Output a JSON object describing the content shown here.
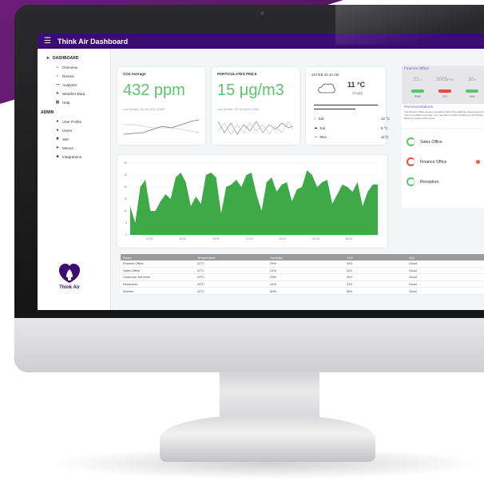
{
  "header": {
    "menu_icon": "menu-icon",
    "title": "Think Air Dashboard"
  },
  "sidebar": {
    "dashboard_heading": "DASHBOARD",
    "dashboard_items": [
      {
        "label": "Overview",
        "icon": "home-icon"
      },
      {
        "label": "Rooms",
        "icon": "home-icon"
      },
      {
        "label": "Analytics",
        "icon": "chart-line-icon"
      },
      {
        "label": "Weather Data",
        "icon": "send-icon"
      },
      {
        "label": "Help",
        "icon": "calendar-icon"
      }
    ],
    "admin_heading": "ADMIN",
    "admin_items": [
      {
        "label": "User Profile",
        "icon": "user-icon"
      },
      {
        "label": "Users",
        "icon": "users-icon"
      },
      {
        "label": "Site",
        "icon": "tools-icon"
      },
      {
        "label": "Menus",
        "icon": "send-icon"
      },
      {
        "label": "Integrations",
        "icon": "file-icon"
      }
    ],
    "logo_text": "Think Air"
  },
  "co2_card": {
    "title": "CO2 Average",
    "value": "432 ppm",
    "updated": "Last Update: 18 Feb 2020 10AM"
  },
  "pm_card": {
    "title": "PARTICULATES PM2.5",
    "value": "15 μg/m3",
    "updated": "Last Update: 18 Feb 2020 10AM"
  },
  "weather": {
    "date": "18 FEB 20 10 AM",
    "temp": "11 °C",
    "condition": "cloudy",
    "forecast": [
      {
        "day": "Sat",
        "temp": "12 °C",
        "icon": "sun-icon"
      },
      {
        "day": "Sat",
        "temp": "8 °C",
        "icon": "cloud-icon"
      },
      {
        "day": "Mon",
        "temp": "11°C",
        "icon": "cloud-icon"
      }
    ]
  },
  "finance_office": {
    "title": "Finance Office",
    "metrics": [
      {
        "value": "21",
        "unit": "°C",
        "label": "TEMP",
        "color": "#5cc46b"
      },
      {
        "value": "2005",
        "unit": "PPM",
        "label": "CO2",
        "color": "#e74c3c"
      },
      {
        "value": "30",
        "unit": "%",
        "label": "HUM",
        "color": "#5cc46b"
      }
    ],
    "recommendations_title": "Recomendations",
    "recommendations_text": "The Finance Office shows consistently high CO2 readings, please ensure that room is ventilated correctly. You may also consider installing an Air Purifier or Plants to reduce CO2 Levels."
  },
  "rooms_status": [
    {
      "name": "Sales Office",
      "status": "ok"
    },
    {
      "name": "Finance Office",
      "status": "alert",
      "alert_count": "0"
    },
    {
      "name": "Reception",
      "status": "ok"
    }
  ],
  "chart_data": {
    "type": "area",
    "y_ticks": [
      "0",
      "5",
      "10",
      "15",
      "20",
      "25",
      "30"
    ],
    "ylim": [
      0,
      30
    ],
    "x_ticks": [
      "12:00",
      "15:00",
      "18:00",
      "21:00",
      "00:00",
      "03:00",
      "06:00"
    ],
    "values": [
      12,
      5,
      20,
      23,
      10,
      10,
      14,
      17,
      15,
      24,
      26,
      22,
      12,
      16,
      13,
      25,
      26,
      24,
      9,
      20,
      21,
      23,
      20,
      25,
      26,
      17,
      10,
      22,
      24,
      18,
      21,
      22,
      14,
      19,
      20,
      27,
      25,
      20,
      22,
      23,
      13,
      17,
      21,
      20,
      18,
      22,
      12,
      18,
      21,
      21
    ],
    "color": "#3daa47"
  },
  "table": {
    "headers": [
      "Room",
      "Temperature",
      "Humidity",
      "CO2",
      "AQI"
    ],
    "rows": [
      [
        "Finance Office",
        "22°C",
        "29%",
        "453",
        "Good"
      ],
      [
        "Sales Office",
        "22°C",
        "21%",
        "423",
        "Good"
      ],
      [
        "Customer Services",
        "22°C",
        "29%",
        "353",
        "Good"
      ],
      [
        "Reception",
        "20°C",
        "22%",
        "375",
        "Good"
      ],
      [
        "Kitchen",
        "22°C",
        "40%",
        "854",
        "Good"
      ]
    ]
  }
}
